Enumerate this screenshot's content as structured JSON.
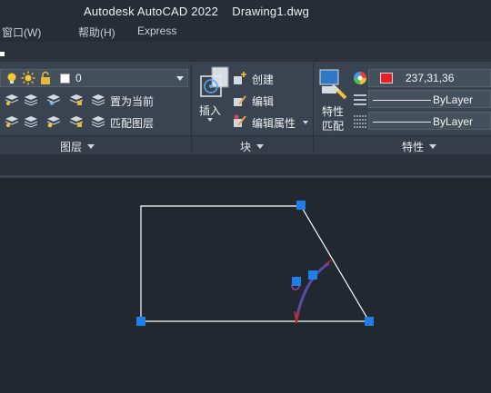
{
  "window": {
    "title": "Autodesk AutoCAD 2022    Drawing1.dwg"
  },
  "menu": {
    "items": [
      "窗口(W)",
      "帮助(H)",
      "Express"
    ]
  },
  "layers_panel": {
    "title": "图层",
    "current_layer": "0",
    "set_current_label": "置为当前",
    "match_layer_label": "匹配图层"
  },
  "block_panel": {
    "title": "块",
    "insert_label": "插入",
    "create_label": "创建",
    "edit_label": "编辑",
    "edit_attributes_label": "编辑属性"
  },
  "properties_panel": {
    "title": "特性",
    "match_label_1": "特性",
    "match_label_2": "匹配",
    "color_value": "237,31,36",
    "color_hex": "#ed1f24",
    "linetype_value": "ByLayer",
    "lineweight_value": "ByLayer"
  },
  "colors": {
    "grip": "#1e7fe8",
    "arc": "#5b4aa8",
    "arc_tip": "#b02a2a",
    "shape_stroke": "#ffffff"
  }
}
